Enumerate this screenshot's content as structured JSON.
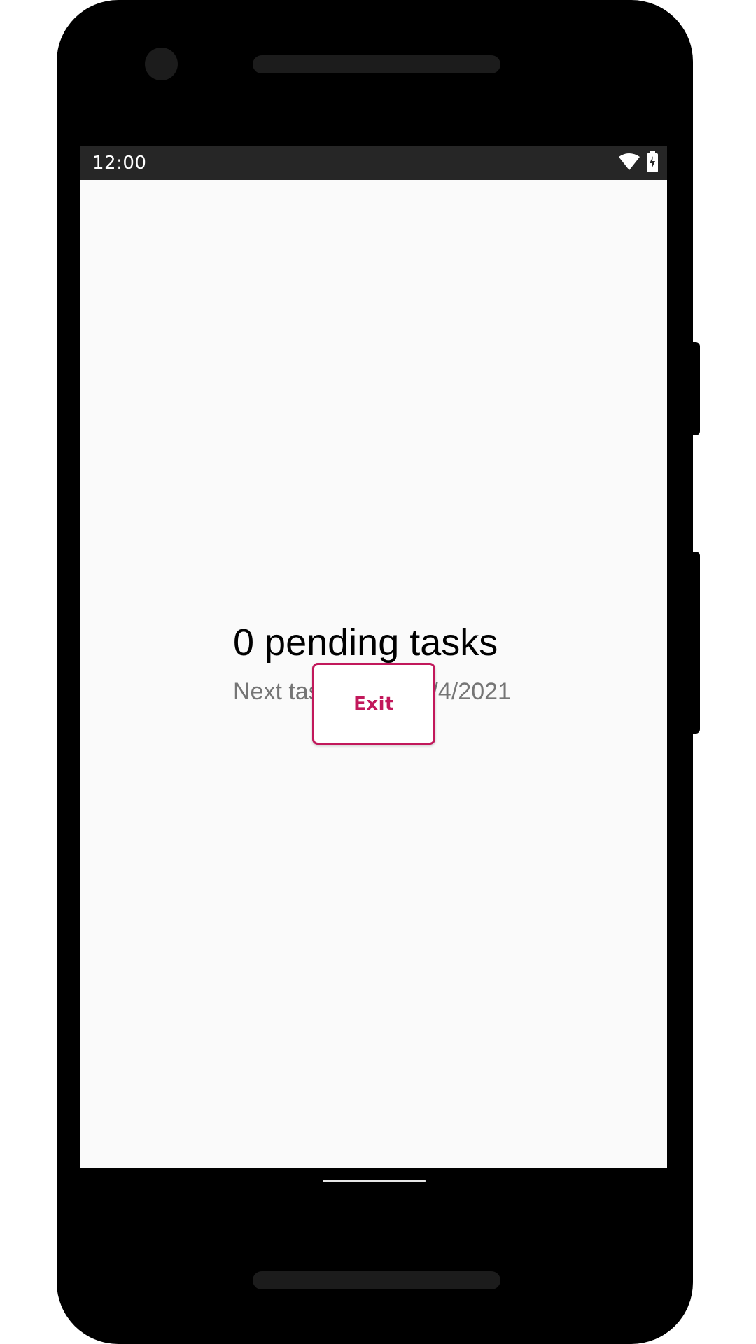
{
  "status_bar": {
    "time": "12:00",
    "wifi_icon": "wifi-icon",
    "battery_icon": "battery-charging-icon"
  },
  "main": {
    "title": "0 pending tasks",
    "subtitle": "Next task: 9:00, 23/4/2021",
    "exit_label": "Exit"
  },
  "colors": {
    "accent": "#c2185b",
    "status_bar_bg": "#262626",
    "screen_bg": "#fafafa",
    "subtitle_text": "#757575"
  }
}
